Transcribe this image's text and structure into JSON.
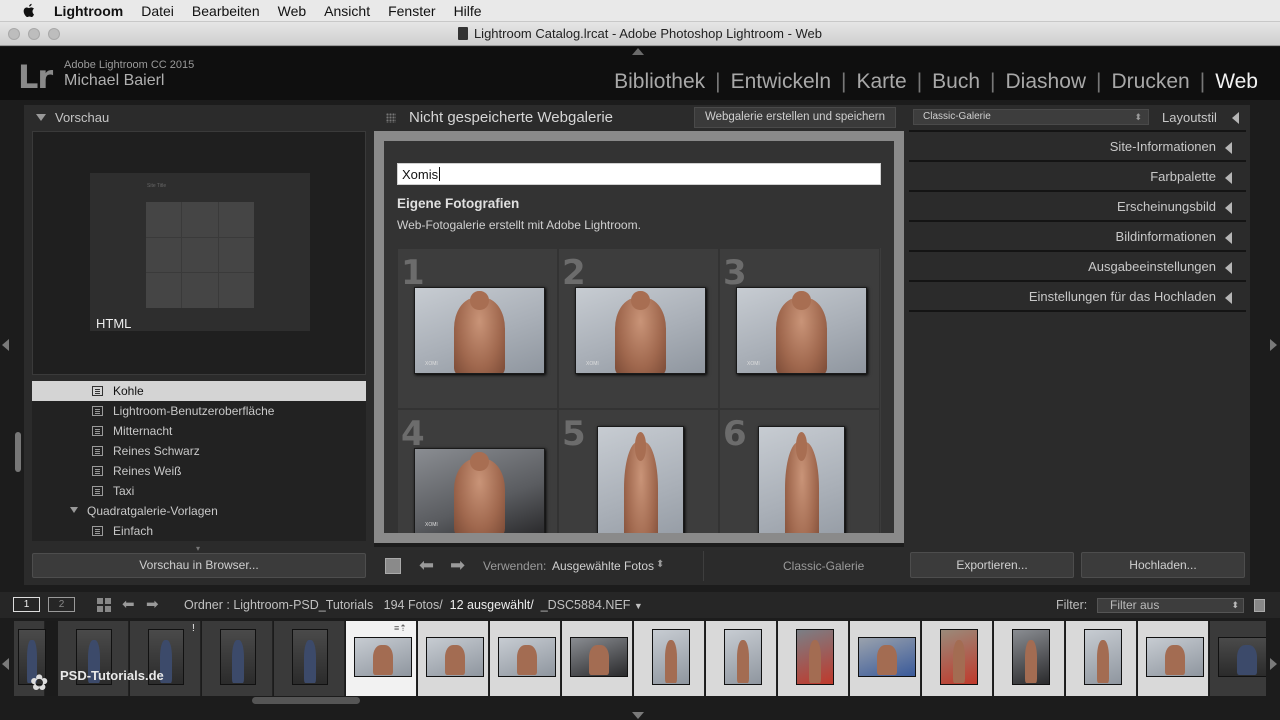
{
  "menubar": {
    "items": [
      "Lightroom",
      "Datei",
      "Bearbeiten",
      "Web",
      "Ansicht",
      "Fenster",
      "Hilfe"
    ]
  },
  "window": {
    "title": "Lightroom Catalog.lrcat - Adobe Photoshop Lightroom - Web"
  },
  "identity": {
    "logo": "Lr",
    "product": "Adobe Lightroom CC 2015",
    "user": "Michael Baierl"
  },
  "modules": [
    "Bibliothek",
    "Entwickeln",
    "Karte",
    "Buch",
    "Diashow",
    "Drucken",
    "Web"
  ],
  "active_module": "Web",
  "left_panel": {
    "preview_header": "Vorschau",
    "preview_label": "HTML",
    "preview_site_title": "Site Title",
    "templates": [
      {
        "label": "Kohle",
        "selected": true
      },
      {
        "label": "Lightroom-Benutzeroberfläche"
      },
      {
        "label": "Mitternacht"
      },
      {
        "label": "Reines Schwarz"
      },
      {
        "label": "Reines Weiß"
      },
      {
        "label": "Taxi"
      }
    ],
    "folder": "Quadratgalerie-Vorlagen",
    "folder_items": [
      "Einfach"
    ],
    "preview_browser_button": "Vorschau in Browser..."
  },
  "center": {
    "gallery_title": "Nicht gespeicherte Webgalerie",
    "create_button": "Webgalerie erstellen und speichern",
    "site_title_value": "Xomis",
    "collection_title": "Eigene Fotografien",
    "collection_desc": "Web-Fotogalerie erstellt mit Adobe Lightroom.",
    "grid_numbers": [
      "1",
      "2",
      "3",
      "4",
      "5",
      "6"
    ],
    "toolbar": {
      "use_label": "Verwenden:",
      "use_value": "Ausgewählte Fotos",
      "gallery_name": "Classic-Galerie"
    }
  },
  "right_panel": {
    "layout_select": "Classic-Galerie",
    "layout_label": "Layoutstil",
    "sections": [
      "Site-Informationen",
      "Farbpalette",
      "Erscheinungsbild",
      "Bildinformationen",
      "Ausgabeeinstellungen",
      "Einstellungen für das Hochladen"
    ],
    "export_button": "Exportieren...",
    "upload_button": "Hochladen..."
  },
  "filmstrip_bar": {
    "screen1": "1",
    "screen2": "2",
    "source_prefix": "Ordner : Lightroom-PSD_Tutorials",
    "photo_count": "194 Fotos/",
    "selected": "12 ausgewählt/",
    "file": "_DSC5884.NEF",
    "filter_label": "Filter:",
    "filter_value": "Filter aus"
  },
  "watermark": "PSD-Tutorials.de"
}
